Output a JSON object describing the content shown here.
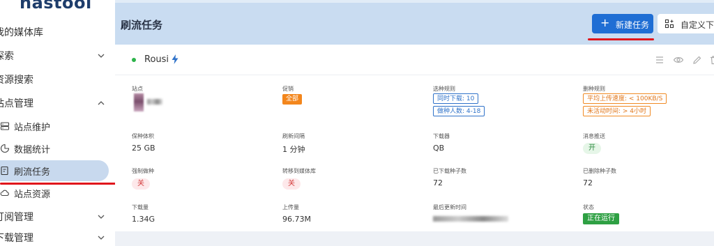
{
  "sidebar": {
    "logo": "nastool",
    "items": [
      {
        "label": "我的媒体库"
      },
      {
        "label": "探索"
      },
      {
        "label": "资源搜索"
      },
      {
        "label": "站点管理"
      },
      {
        "label": "站点维护"
      },
      {
        "label": "数据统计"
      },
      {
        "label": "刷流任务"
      },
      {
        "label": "站点资源"
      },
      {
        "label": "订阅管理"
      },
      {
        "label": "下载管理"
      }
    ]
  },
  "header": {
    "title": "刷流任务",
    "new_task_label": "新建任务",
    "custom_download_label": "自定义下载"
  },
  "card": {
    "site_name": "Rousi",
    "status_color": "#2db34a",
    "fields": {
      "site": {
        "label": "站点"
      },
      "promo": {
        "label": "促销",
        "tag": "全部"
      },
      "seed_rules": {
        "label": "选种规则",
        "tags": [
          "同时下载: 10",
          "做种人数: 4-18"
        ]
      },
      "delete_rules": {
        "label": "删种规则",
        "tags": [
          "平均上传速度: < 100KB/S",
          "未活动时间: > 4小时"
        ]
      },
      "seed_size": {
        "label": "保种体积",
        "value": "25 GB"
      },
      "refresh_interval": {
        "label": "刷新间隔",
        "value": "1 分钟"
      },
      "downloader": {
        "label": "下载器",
        "value": "QB"
      },
      "notify": {
        "label": "消息推送",
        "value": "开"
      },
      "force_seed": {
        "label": "强制做种",
        "value": "关"
      },
      "transfer_to_library": {
        "label": "转移到媒体库",
        "value": "关"
      },
      "downloaded_count": {
        "label": "已下载种子数",
        "value": "72"
      },
      "deleted_count": {
        "label": "已删除种子数",
        "value": "72"
      },
      "download_amount": {
        "label": "下载量",
        "value": "1.34G"
      },
      "upload_amount": {
        "label": "上传量",
        "value": "96.73M"
      },
      "last_update": {
        "label": "最后更新时间"
      },
      "state": {
        "label": "状态",
        "value": "正在运行"
      }
    }
  },
  "colors": {
    "primary": "#1f6ed4",
    "header_bg": "#c9dcf1",
    "active_nav": "#c8d9ee",
    "annotation_red": "#e0161c"
  }
}
